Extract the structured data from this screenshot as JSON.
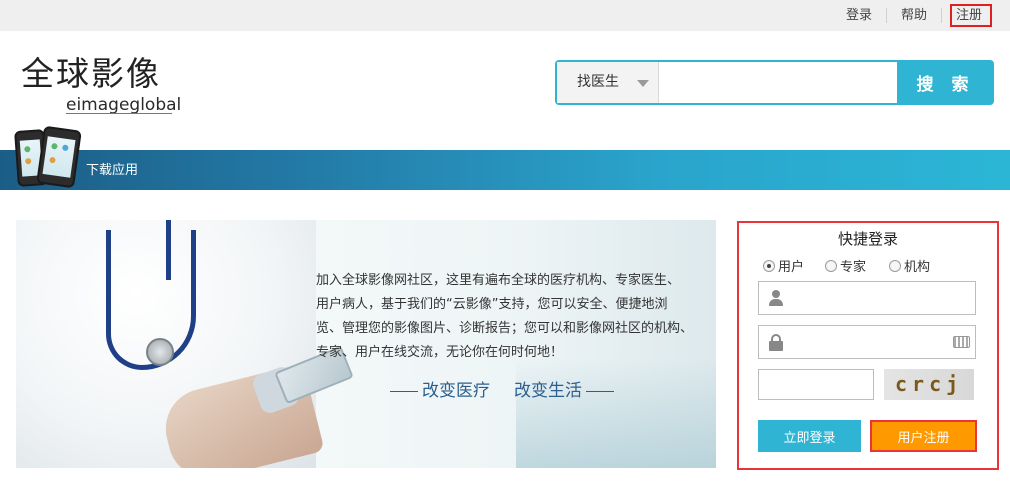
{
  "topbar": {
    "login": "登录",
    "help": "帮助",
    "register": "注册"
  },
  "logo": {
    "cn": "全球影像",
    "en": "eimageglobal"
  },
  "search": {
    "category": "找医生",
    "placeholder": "",
    "button": "搜 索"
  },
  "banner": {
    "download": "下载应用"
  },
  "hero": {
    "lines": [
      "加入全球影像网社区，这里有遍布全球的医疗机构、专家医生、",
      "用户病人，基于我们的“云影像”支持，您可以安全、便捷地浏",
      "览、管理您的影像图片、诊断报告；您可以和影像网社区的机构、",
      "专家、用户在线交流，无论你在何时何地！"
    ],
    "slogan_left": "改变医疗",
    "slogan_right": "改变生活"
  },
  "login": {
    "title": "快捷登录",
    "roles": [
      "用户",
      "专家",
      "机构"
    ],
    "selected_role": "用户",
    "username_value": "",
    "password_value": "",
    "captcha_value": "",
    "captcha_text": "crcj",
    "login_button": "立即登录",
    "register_button": "用户注册"
  },
  "colors": {
    "accent": "#2fb4d4",
    "highlight_border": "#e8343a",
    "register_button": "#ff9900",
    "banner_dark": "#1b5d86"
  }
}
